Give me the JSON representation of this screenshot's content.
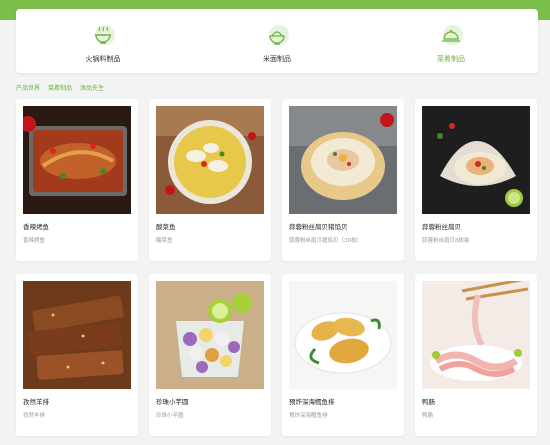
{
  "tabs": [
    {
      "label": "火锅料制品",
      "icon": "hotpot-bowl-icon",
      "active": false
    },
    {
      "label": "米面制品",
      "icon": "rice-bowl-icon",
      "active": false
    },
    {
      "label": "菜肴制品",
      "icon": "dish-cloche-icon",
      "active": true
    }
  ],
  "breadcrumb": [
    "产品世界",
    "菜肴制品",
    "添品先生"
  ],
  "accent_color": "#6cb33f",
  "header_color": "#7cbf4b",
  "products": [
    {
      "title": "香辣烤鱼",
      "sub": "香辣烤鱼",
      "image": "grilled-fish-image"
    },
    {
      "title": "酸菜鱼",
      "sub": "酸菜鱼",
      "image": "pickled-fish-image"
    },
    {
      "title": "蒜蓉粉丝扇贝猪馅贝",
      "sub": "蒜蓉粉丝扇贝猪馅贝（30枚）",
      "image": "steamed-scallop-image"
    },
    {
      "title": "蒜蓉粉丝扇贝",
      "sub": "蒜蓉粉丝扇贝8枚装",
      "image": "garlic-scallop-image"
    },
    {
      "title": "孜然羊排",
      "sub": "孜然羊排",
      "image": "cumin-lamb-ribs-image"
    },
    {
      "title": "珍珠小芋圆",
      "sub": "珍珠小芋圆",
      "image": "taro-balls-image"
    },
    {
      "title": "预炸深海鳕鱼排",
      "sub": "预炸深海鳕鱼排",
      "image": "fried-cod-image"
    },
    {
      "title": "鸭肠",
      "sub": "鸭肠",
      "image": "duck-intestine-image"
    }
  ]
}
